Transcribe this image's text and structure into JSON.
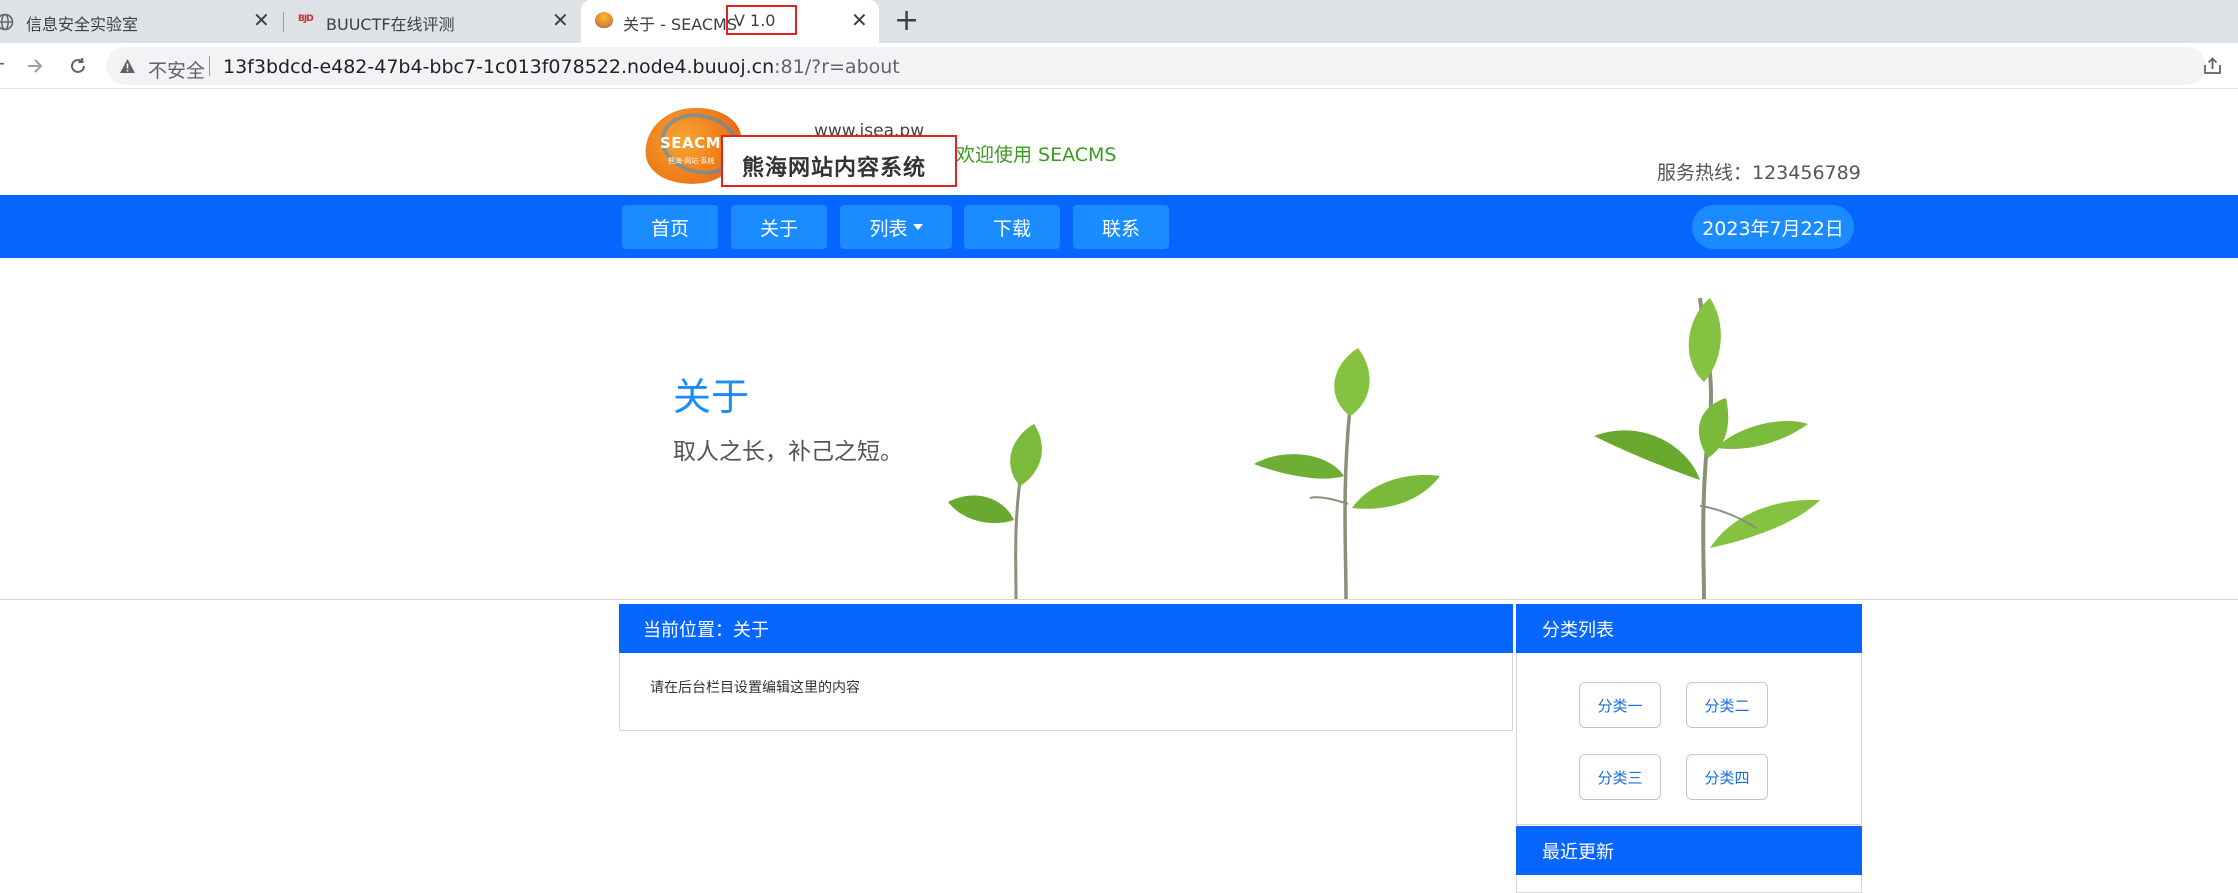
{
  "browser": {
    "tabs": [
      {
        "title": "信息安全实验室",
        "active": false
      },
      {
        "title": "BUUCTF在线评测",
        "active": false
      },
      {
        "title": "关于 - SEACMS V 1.0",
        "title_main": "关于 - SEACMS",
        "title_version": "V 1.0",
        "active": true
      }
    ],
    "security_label": "不安全",
    "url_host": "13f3bdcd-e482-47b4-bbc7-1c013f078522.node4.buuoj.cn",
    "url_path": ":81/?r=about"
  },
  "header": {
    "logo_text": "SEACMS",
    "logo_tagline": "熊海·网站·系统",
    "site_url": "www.isea.pw",
    "site_name": "熊海网站内容系统",
    "welcome": "欢迎使用 SEACMS",
    "hotline": "服务热线：123456789"
  },
  "nav": {
    "items": [
      "首页",
      "关于",
      "列表",
      "下载",
      "联系"
    ],
    "date": "2023年7月22日"
  },
  "banner": {
    "title": "关于",
    "subtitle": "取人之长，补己之短。"
  },
  "main": {
    "breadcrumb": "当前位置：关于",
    "content": "请在后台栏目设置编辑这里的内容"
  },
  "sidebar": {
    "category_title": "分类列表",
    "categories": [
      "分类一",
      "分类二",
      "分类三",
      "分类四"
    ],
    "recent_title": "最近更新"
  },
  "colors": {
    "nav_blue": "#0666ff",
    "button_blue": "#1a8cff",
    "welcome_green": "#3a9b21",
    "highlight_red": "#e0231f",
    "logo_orange": "#ef7d1a"
  },
  "icons": [
    "globe-icon",
    "buuctf-favicon",
    "seacms-favicon",
    "close-icon",
    "plus-icon",
    "back-icon",
    "forward-icon",
    "reload-icon",
    "warning-icon",
    "share-icon"
  ]
}
